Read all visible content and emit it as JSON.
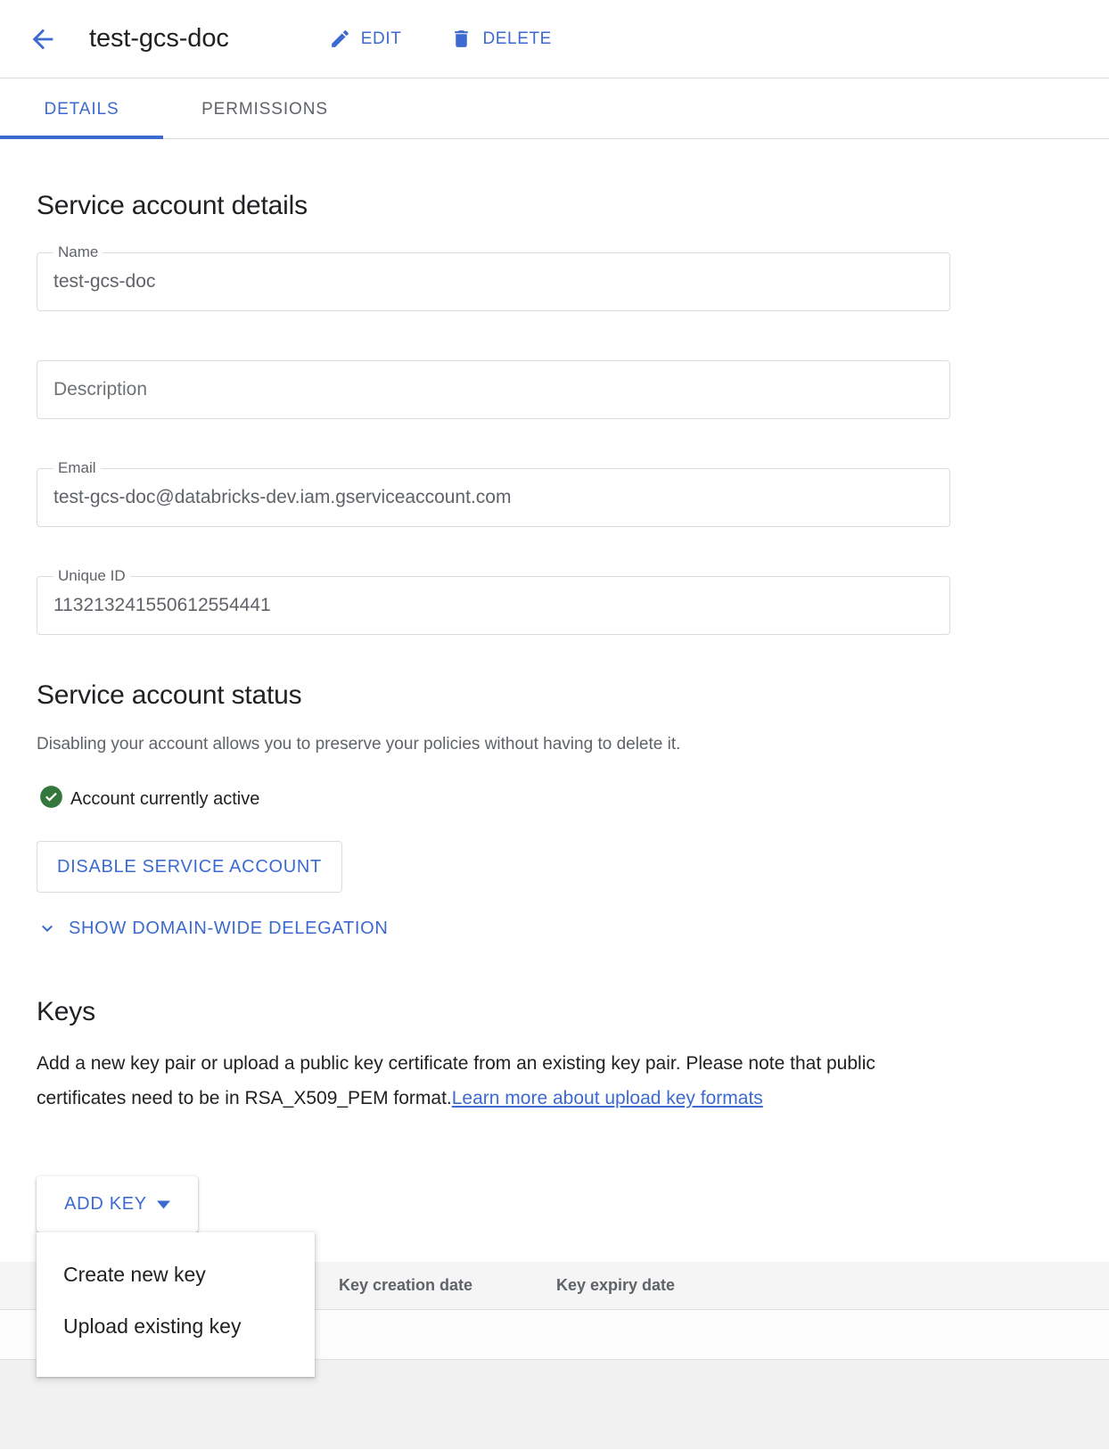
{
  "header": {
    "back_icon": "arrow-left-icon",
    "title": "test-gcs-doc",
    "actions": [
      {
        "icon": "pencil-icon",
        "label": "EDIT"
      },
      {
        "icon": "trash-icon",
        "label": "DELETE"
      }
    ]
  },
  "tabs": [
    {
      "label": "DETAILS",
      "active": true
    },
    {
      "label": "PERMISSIONS",
      "active": false
    }
  ],
  "details": {
    "heading": "Service account details",
    "fields": [
      {
        "label": "Name",
        "value": "test-gcs-doc",
        "is_placeholder": false
      },
      {
        "label": "",
        "value": "Description",
        "is_placeholder": true
      },
      {
        "label": "Email",
        "value": "test-gcs-doc@databricks-dev.iam.gserviceaccount.com",
        "is_placeholder": false
      },
      {
        "label": "Unique ID",
        "value": "113213241550612554441",
        "is_placeholder": false
      }
    ]
  },
  "status": {
    "heading": "Service account status",
    "description": "Disabling your account allows you to preserve your policies without having to delete it.",
    "badge_icon": "check-circle-icon",
    "badge_color": "#34773c",
    "badge_text": "Account currently active",
    "disable_button": "DISABLE SERVICE ACCOUNT",
    "delegation_icon": "chevron-down-icon",
    "delegation_link": "SHOW DOMAIN-WIDE DELEGATION"
  },
  "keys": {
    "heading": "Keys",
    "description_part1": "Add a new key pair or upload a public key certificate from an existing key pair. Please note that public certificates need to be in RSA_X509_PEM format.",
    "description_link": "Learn more about upload key formats",
    "add_key_button": "ADD KEY",
    "add_key_caret_icon": "caret-down-icon",
    "menu_items": [
      {
        "label": "Create new key"
      },
      {
        "label": "Upload existing key"
      }
    ],
    "table": {
      "columns": [
        "",
        "Key creation date",
        "Key expiry date",
        ""
      ],
      "rows": []
    }
  },
  "colors": {
    "accent": "#3c6ad0",
    "link": "#3c6ad0",
    "success": "#34773c",
    "border": "#dadce0",
    "muted_text": "#5f6368"
  }
}
